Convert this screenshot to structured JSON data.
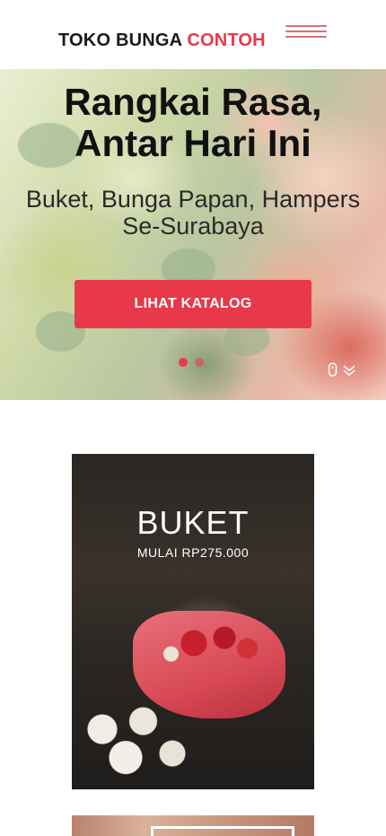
{
  "header": {
    "logo_main": "TOKO BUNGA ",
    "logo_accent": "CONTOH"
  },
  "hero": {
    "title_line1": "Rangkai Rasa,",
    "title_line2": "Antar Hari Ini",
    "subtitle_line1": "Buket, Bunga Papan, Hampers",
    "subtitle_line2": "Se-Surabaya",
    "cta_label": "LIHAT KATALOG",
    "slide_count": 2,
    "active_slide": 1
  },
  "categories": [
    {
      "title": "BUKET",
      "price": "MULAI RP275.000"
    }
  ],
  "colors": {
    "accent": "#e8394a",
    "menu_lines": "#d9707c",
    "text_dark": "#111111"
  },
  "icons": [
    "hamburger-menu-icon",
    "mouse-scroll-icon",
    "double-chevron-down-icon"
  ]
}
